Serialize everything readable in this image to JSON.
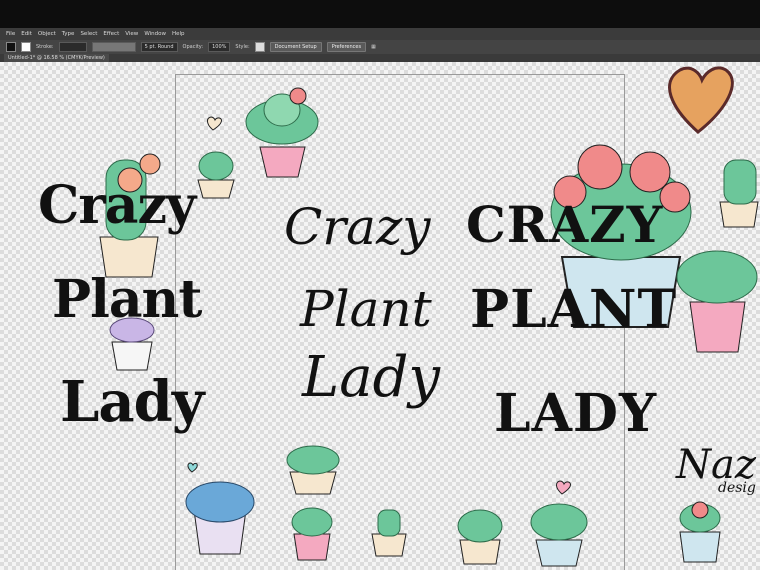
{
  "menu": {
    "items": [
      "File",
      "Edit",
      "Object",
      "Type",
      "Select",
      "Effect",
      "View",
      "Window",
      "Help"
    ]
  },
  "control_bar": {
    "stroke_label": "Stroke:",
    "brush_value": "5 pt. Round",
    "opacity_label": "Opacity:",
    "opacity_value": "100%",
    "style_label": "Style:",
    "document_setup": "Document Setup",
    "preferences": "Preferences"
  },
  "document_tab": {
    "title": "Untitled-1* @ 16.58 % (CMYK/Preview)"
  },
  "artwork": {
    "left_stack": [
      "Crazy",
      "Plant",
      "Lady"
    ],
    "center_stack": [
      "Crazy",
      "Plant",
      "Lady"
    ],
    "right_stack": [
      "CRAZY",
      "PLANT",
      "LADY"
    ],
    "signature_main": "Naz",
    "signature_sub": "desig"
  },
  "colors": {
    "text": "#111111",
    "leaf": "#6cc69a",
    "pot_pink": "#f4a9c0",
    "pot_cream": "#f6e7cf",
    "pot_blue": "#cfe6ef",
    "flower": "#f08a8a",
    "heart": "#e6a25f"
  }
}
